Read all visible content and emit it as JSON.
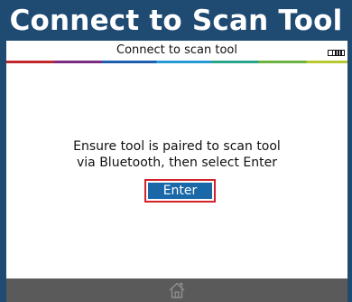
{
  "banner": {
    "title": "Connect to Scan Tool"
  },
  "screen": {
    "title": "Connect to scan tool",
    "battery_icon": "battery-full-icon"
  },
  "body": {
    "message_line1": "Ensure tool is paired to scan tool",
    "message_line2": "via Bluetooth, then select Enter",
    "enter_label": "Enter"
  },
  "footer": {
    "home_icon": "home-icon"
  },
  "colors": {
    "frame": "#1f4a72",
    "button": "#1a68a8",
    "button_focus_border": "#d4222a",
    "footer": "#5a5a5a"
  }
}
